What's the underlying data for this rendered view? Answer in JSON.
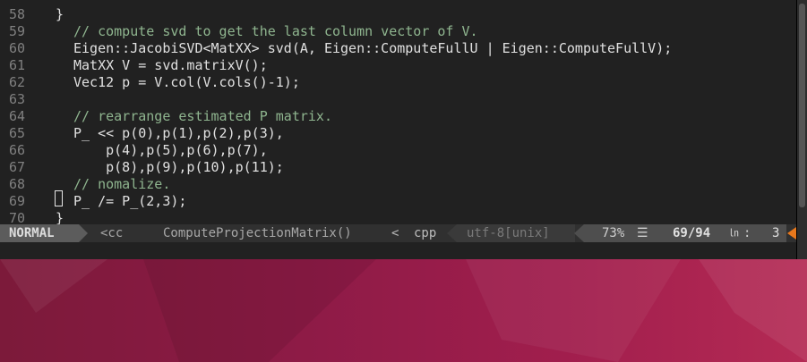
{
  "editor": {
    "lines": [
      {
        "n": "58",
        "text": "",
        "kind": "code"
      },
      {
        "n": "59",
        "text": "// compute svd to get the last column vector of V.",
        "kind": "cmt"
      },
      {
        "n": "60",
        "text": "Eigen::JacobiSVD<MatXX> svd(A, Eigen::ComputeFullU | Eigen::ComputeFullV);",
        "kind": "code"
      },
      {
        "n": "61",
        "text": "MatXX V = svd.matrixV();",
        "kind": "code"
      },
      {
        "n": "62",
        "text": "Vec12 p = V.col(V.cols()-1);",
        "kind": "code"
      },
      {
        "n": "63",
        "text": "",
        "kind": "code"
      },
      {
        "n": "64",
        "text": "// rearrange estimated P matrix.",
        "kind": "cmt"
      },
      {
        "n": "65",
        "text": "P_ << p(0),p(1),p(2),p(3),",
        "kind": "code"
      },
      {
        "n": "66",
        "text": "    p(4),p(5),p(6),p(7),",
        "kind": "code"
      },
      {
        "n": "67",
        "text": "    p(8),p(9),p(10),p(11);",
        "kind": "code"
      },
      {
        "n": "68",
        "text": "// nomalize.",
        "kind": "cmt"
      },
      {
        "n": "69",
        "text": "P_ /= P_(2,3);",
        "kind": "code"
      },
      {
        "n": "70",
        "text": "}",
        "kind": "brace"
      }
    ],
    "top_partial": "}"
  },
  "statusline": {
    "mode": "NORMAL",
    "buffer": "<cc",
    "function": "ComputeProjectionMatrix()",
    "separator": "<",
    "filetype": "cpp",
    "encoding": "utf-8[unix]",
    "percent": "73%",
    "percent_icon": "☰",
    "position": "69/94",
    "line_icon": "㏑",
    "col_separator": ":",
    "column": "3"
  },
  "colors": {
    "terminal_bg": "#212121",
    "comment": "#8fb58f",
    "warning": "#e8781c"
  }
}
